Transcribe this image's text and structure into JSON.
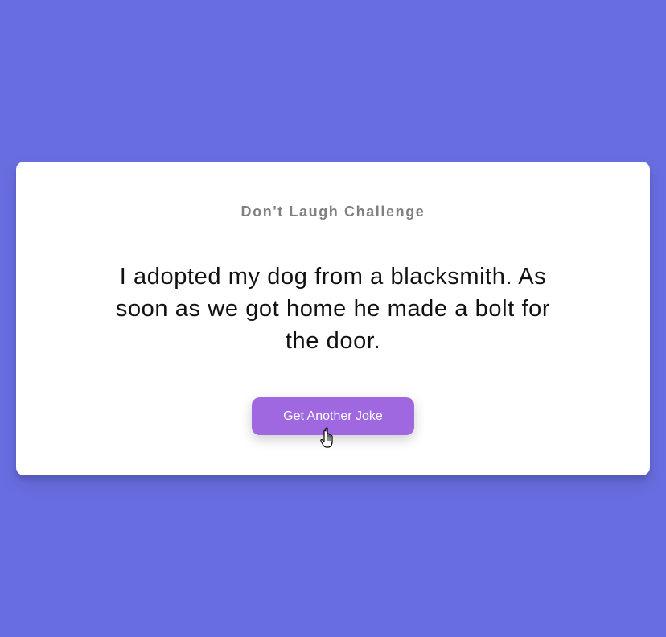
{
  "app": {
    "title": "Don't Laugh Challenge"
  },
  "joke": {
    "text": "I adopted my dog from a blacksmith. As soon as we got home he made a bolt for the door."
  },
  "actions": {
    "next_joke_label": "Get Another Joke"
  },
  "cursor": {
    "type": "hand-pointer-icon"
  },
  "colors": {
    "background": "#686de0",
    "card": "#ffffff",
    "title": "#808080",
    "joke_text": "#111111",
    "button": "#9f68e0",
    "button_text": "#ffffff"
  }
}
